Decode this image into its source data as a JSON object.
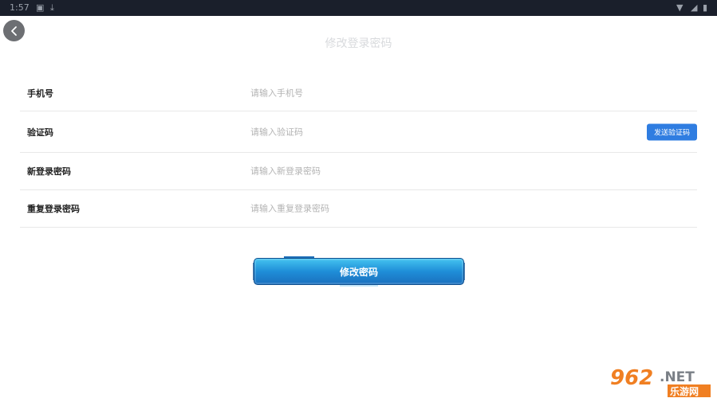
{
  "status_bar": {
    "time": "1:57"
  },
  "page": {
    "title": "修改登录密码"
  },
  "form": {
    "rows": [
      {
        "label": "手机号",
        "placeholder": "请输入手机号"
      },
      {
        "label": "验证码",
        "placeholder": "请输入验证码",
        "action": "发送验证码"
      },
      {
        "label": "新登录密码",
        "placeholder": "请输入新登录密码"
      },
      {
        "label": "重复登录密码",
        "placeholder": "请输入重复登录密码"
      }
    ]
  },
  "submit": {
    "label": "修改密码"
  },
  "watermark": {
    "text": "962.NET",
    "subtext": "乐游网"
  },
  "colors": {
    "accent": "#2f7de1",
    "submit_top": "#44c3f0",
    "submit_bottom": "#1a6fbe"
  }
}
